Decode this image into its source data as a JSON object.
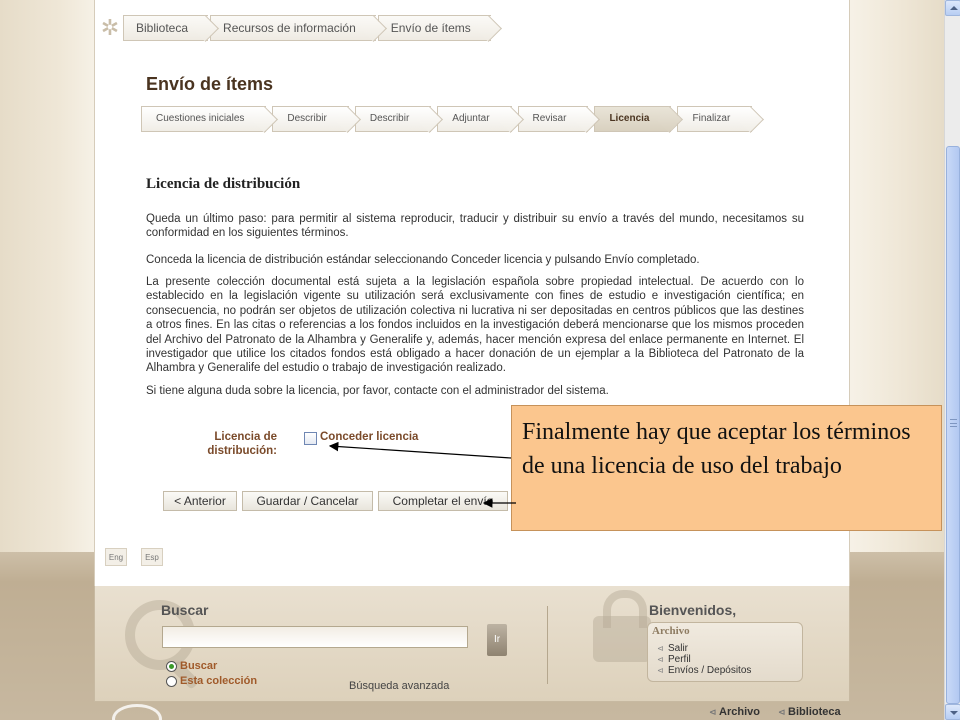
{
  "breadcrumb": [
    "Biblioteca",
    "Recursos de información",
    "Envío de ítems"
  ],
  "page_title": "Envío de ítems",
  "steps": [
    {
      "label": "Cuestiones iniciales",
      "active": false
    },
    {
      "label": "Describir",
      "active": false
    },
    {
      "label": "Describir",
      "active": false
    },
    {
      "label": "Adjuntar",
      "active": false
    },
    {
      "label": "Revisar",
      "active": false
    },
    {
      "label": "Licencia",
      "active": true
    },
    {
      "label": "Finalizar",
      "active": false
    }
  ],
  "section_title": "Licencia de distribución",
  "paragraphs": [
    "Queda un último paso: para permitir al sistema reproducir, traducir y distribuir su envío a través del mundo, necesitamos su conformidad en los siguientes términos.",
    "Conceda la licencia de distribución estándar seleccionando Conceder licencia y pulsando Envío completado.",
    "La presente colección documental está sujeta a la legislación española sobre propiedad intelectual. De acuerdo con lo establecido en la legislación vigente su utilización será exclusivamente con fines de estudio e investigación científica; en consecuencia, no podrán ser objetos de utilización colectiva ni lucrativa ni ser depositadas en centros públicos que las destines a otros fines. En las citas o referencias a los fondos incluidos en la investigación deberá mencionarse que los mismos proceden del Archivo del Patronato de la Alhambra y Generalife y, además, hacer mención expresa del enlace permanente en Internet. El investigador que utilice los citados fondos está obligado a hacer donación de un ejemplar a la Biblioteca del Patronato de la Alhambra y Generalife del estudio o trabajo de investigación realizado.",
    "Si tiene alguna duda sobre la licencia, por favor, contacte con el administrador del sistema."
  ],
  "license": {
    "label": "Licencia de distribución:",
    "checkbox_label": "Conceder licencia",
    "checked": false
  },
  "buttons": {
    "previous": "< Anterior",
    "save_cancel": "Guardar / Cancelar",
    "complete": "Completar el envío"
  },
  "languages": [
    "Eng",
    "Esp"
  ],
  "footer": {
    "search_title": "Buscar",
    "search_value": "",
    "go_label": "Ir",
    "radio_search": "Buscar",
    "radio_collection": "Esta colección",
    "advanced_search": "Búsqueda avanzada",
    "welcome": "Bienvenidos,",
    "archive_title": "Archivo",
    "archive_links": [
      "Salir",
      "Perfil",
      "Envíos / Depósitos"
    ],
    "bottom_links": [
      "Archivo",
      "Biblioteca"
    ]
  },
  "callout": {
    "text": "Finalmente hay que aceptar los términos de una licencia de uso del trabajo",
    "background": "#fbc68e"
  }
}
